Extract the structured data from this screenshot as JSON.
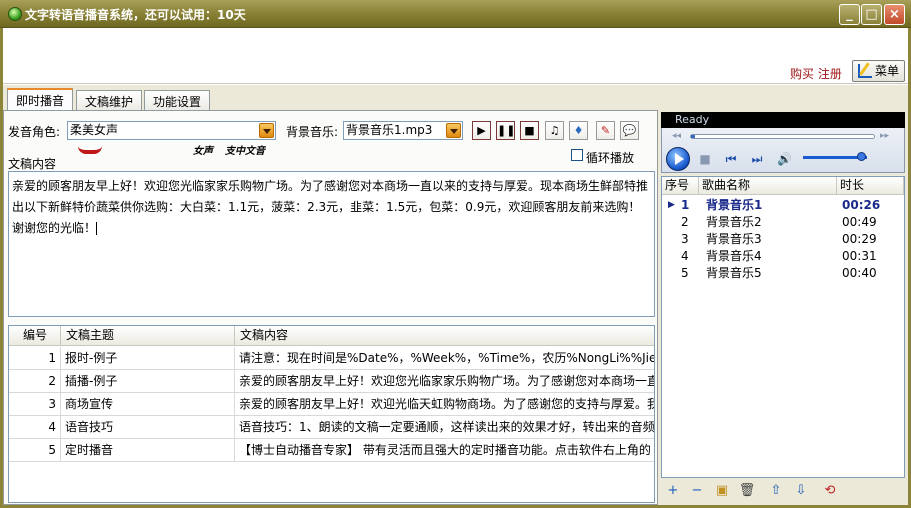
{
  "window": {
    "title": "文字转语音播音系统，还可以试用：10天",
    "min": "_",
    "max": "□",
    "close": "×"
  },
  "header": {
    "buy_register": "购买 注册",
    "menu_label": "菜单"
  },
  "tabs": [
    {
      "label": "即时播音",
      "active": true
    },
    {
      "label": "文稿维护",
      "active": false
    },
    {
      "label": "功能设置",
      "active": false
    }
  ],
  "broadcast": {
    "voice_label": "发音角色:",
    "voice_value": "柔美女声",
    "bgm_label": "背景音乐:",
    "bgm_value": "背景音乐1.mp3",
    "loop_label": "循环播放",
    "loop_checked": false,
    "content_label": "文稿内容",
    "content_text": "亲爱的顾客朋友早上好！欢迎您光临家家乐购物广场。为了感谢您对本商场一直以来的支持与厚爱。现本商场生鲜部特推出以下新鲜特价蔬菜供你选购：大白菜：1.1元，菠菜：2.3元，韭菜：1.5元，包菜：0.9元，欢迎顾客朋友前来选购！谢谢您的光临！",
    "tool_icons": [
      "play-icon",
      "pause-icon",
      "stop-icon",
      "music-icon",
      "voice-icon",
      "record-icon",
      "chat-icon"
    ],
    "tool_glyphs": [
      "▶",
      "❚❚",
      "■",
      "♫",
      "♦",
      "✎",
      "💬"
    ],
    "sig1": "女声",
    "sig2": "支中文音"
  },
  "scripts_table": {
    "columns": [
      "编号",
      "文稿主题",
      "文稿内容"
    ],
    "rows": [
      {
        "id": "1",
        "subject": "报时-例子",
        "content": "请注意：现在时间是%Date%，%Week%，%Time%，农历%NongLi%%Jie%，谢谢您的"
      },
      {
        "id": "2",
        "subject": "插播-例子",
        "content": "亲爱的顾客朋友早上好！欢迎您光临家家乐购物广场。为了感谢您对本商场一直"
      },
      {
        "id": "3",
        "subject": "商场宣传",
        "content": "亲爱的顾客朋友早上好！欢迎光临天虹购物商场。为了感谢您的支持与厚爱。我"
      },
      {
        "id": "4",
        "subject": "语音技巧",
        "content": "语音技巧：1、朗读的文稿一定要通顺，这样读出来的效果才好，转出来的音频"
      },
      {
        "id": "5",
        "subject": "定时播音",
        "content": "【博士自动播音专家】 带有灵活而且强大的定时播音功能。点击软件右上角的"
      }
    ]
  },
  "player": {
    "status": "Ready",
    "volume": 0.9,
    "seek": 0.02
  },
  "playlist": {
    "columns": [
      "序号",
      "歌曲名称",
      "时长"
    ],
    "rows": [
      {
        "no": "1",
        "name": "背景音乐1",
        "duration": "00:26",
        "playing": true
      },
      {
        "no": "2",
        "name": "背景音乐2",
        "duration": "00:49",
        "playing": false
      },
      {
        "no": "3",
        "name": "背景音乐3",
        "duration": "00:29",
        "playing": false
      },
      {
        "no": "4",
        "name": "背景音乐4",
        "duration": "00:31",
        "playing": false
      },
      {
        "no": "5",
        "name": "背景音乐5",
        "duration": "00:40",
        "playing": false
      }
    ],
    "buttons": [
      {
        "name": "add-file-button",
        "glyph": "+"
      },
      {
        "name": "remove-file-button",
        "glyph": "−"
      },
      {
        "name": "add-folder-button",
        "glyph": "▣"
      },
      {
        "name": "delete-button",
        "glyph": "🗑"
      },
      {
        "name": "move-up-button",
        "glyph": "⇧"
      },
      {
        "name": "move-down-button",
        "glyph": "⇩"
      },
      {
        "name": "refresh-button",
        "glyph": "⟲"
      }
    ]
  },
  "colors": {
    "title_bar": "#8c8438",
    "accent_tab": "#e68b2c",
    "buy_text": "#a01818",
    "play_blue": "#1a5ad0"
  }
}
